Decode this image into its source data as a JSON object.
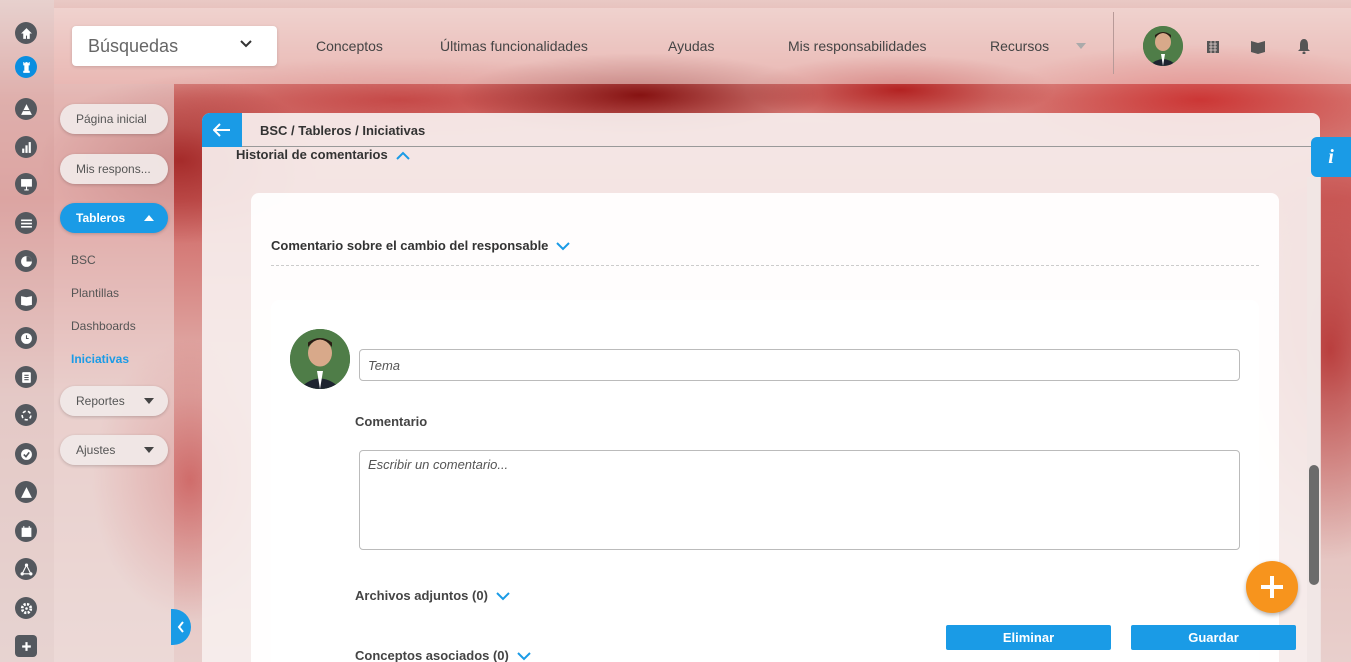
{
  "topbar": {
    "search_label": "Búsquedas",
    "nav": [
      "Conceptos",
      "Últimas funcionalidades",
      "Ayudas",
      "Mis responsabilidades",
      "Recursos"
    ]
  },
  "iconbar": {
    "icons": [
      "home-icon",
      "tower-icon",
      "pyramid-icon",
      "bar-chart-icon",
      "presentation-icon",
      "list-icon",
      "pie-chart-icon",
      "book-icon",
      "clock-icon",
      "document-icon",
      "cycle-icon",
      "check-icon",
      "warning-icon",
      "calendar-icon",
      "network-icon",
      "gear-icon",
      "plus-square-icon"
    ]
  },
  "menu": {
    "pagina_inicial": "Página inicial",
    "mis_respons": "Mis respons...",
    "tableros": "Tableros",
    "tableros_items": [
      "BSC",
      "Plantillas",
      "Dashboards",
      "Iniciativas"
    ],
    "reportes": "Reportes",
    "ajustes": "Ajustes"
  },
  "main": {
    "breadcrumb": "BSC / Tableros / Iniciativas",
    "history_title": "Historial de comentarios",
    "change_comment_title": "Comentario sobre el cambio del responsable",
    "tema_placeholder": "Tema",
    "comentario_label": "Comentario",
    "comentario_placeholder": "Escribir un comentario...",
    "archivos": "Archivos adjuntos (0)",
    "conceptos": "Conceptos asociados (0)",
    "eliminar": "Eliminar",
    "guardar": "Guardar"
  },
  "colors": {
    "accent": "#1a9be6",
    "fab": "#f7941d"
  }
}
